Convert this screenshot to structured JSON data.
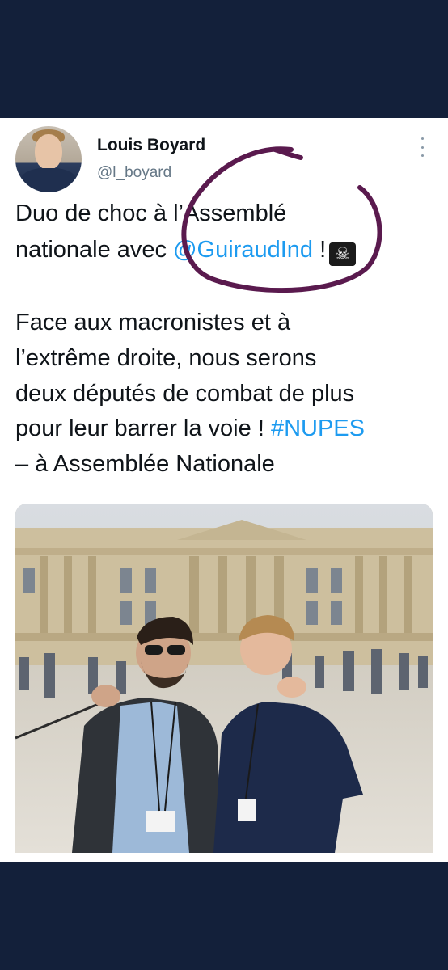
{
  "tweet": {
    "author_name": "Louis Boyard",
    "author_handle": "@l_boyard",
    "line1": "Duo de choc à l’Assemblé",
    "line2_text": "nationale avec ",
    "line2_mention": "@GuiraudInd",
    "line2_tail": " !",
    "line2_emoji": "☠",
    "line3": "Face aux macronistes et à",
    "line4": "l’extrême droite, nous serons",
    "line5": "deux députés de combat de plus",
    "line6_text": "pour leur barrer la voie ! ",
    "line6_hashtag": "#NUPES",
    "line7": "– à Assemblée Nationale"
  },
  "icons": {
    "avatar": "profile-avatar",
    "more": "more-options-icon",
    "emoji": "skull-and-crossbones-emoji"
  },
  "colors": {
    "background": "#13203a",
    "link": "#1d9bf0",
    "annotation_circle": "#5a1a4e"
  }
}
